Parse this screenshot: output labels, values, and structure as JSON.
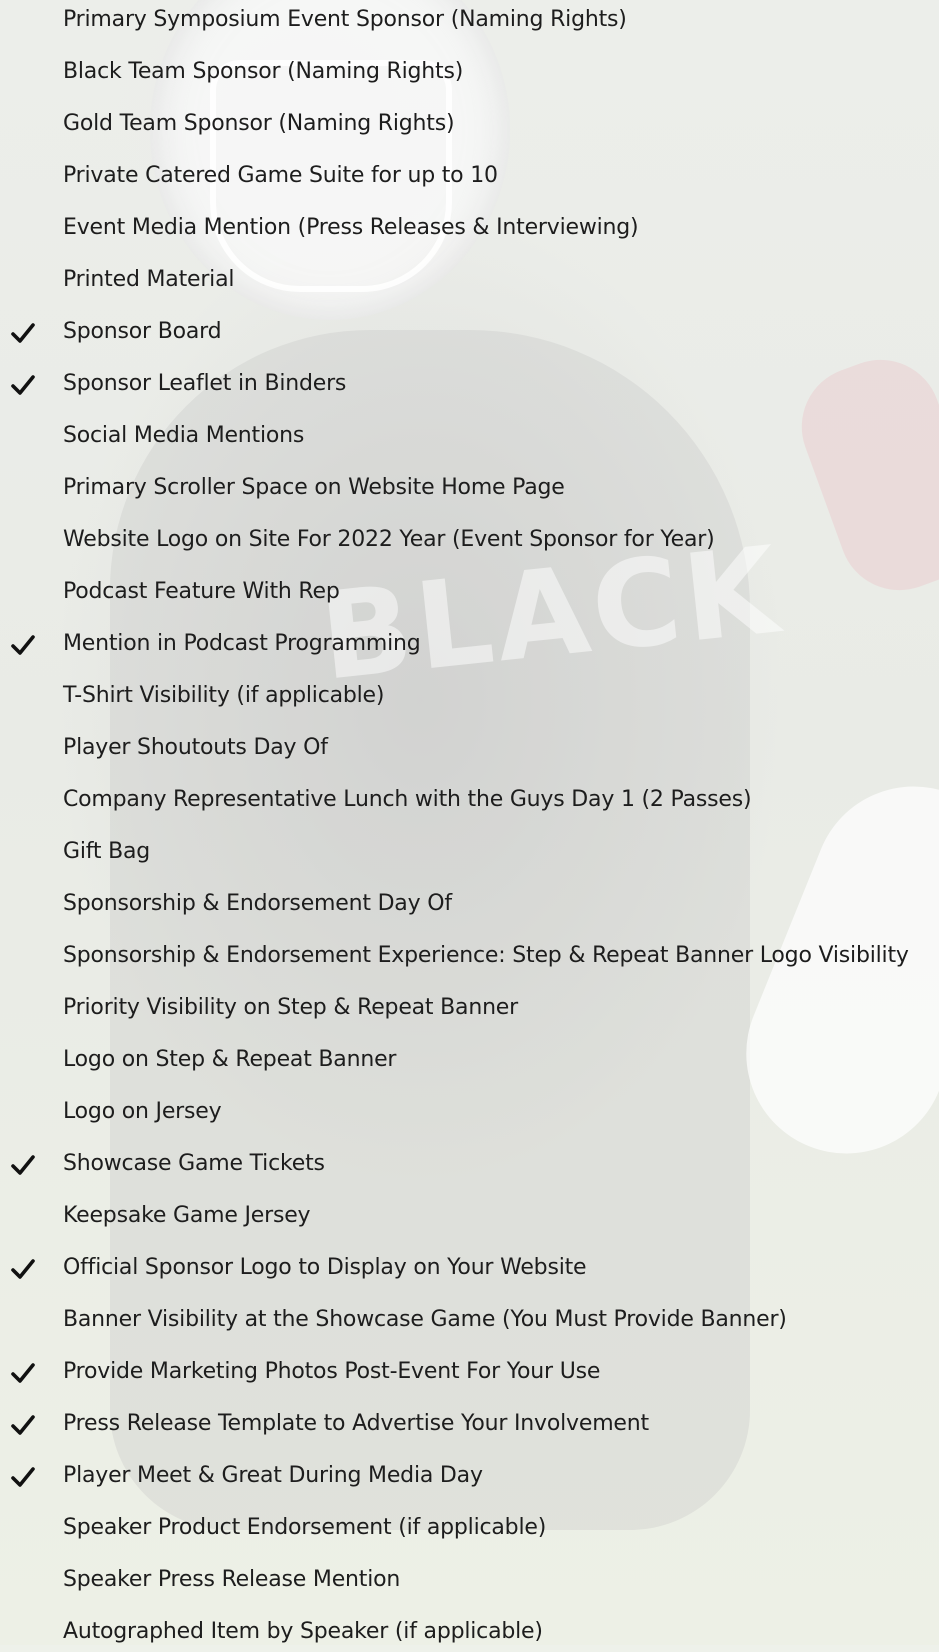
{
  "benefits": [
    {
      "label": "Primary Symposium Event Sponsor (Naming Rights)",
      "included": false
    },
    {
      "label": "Black Team Sponsor (Naming Rights)",
      "included": false
    },
    {
      "label": "Gold Team Sponsor (Naming Rights)",
      "included": false
    },
    {
      "label": "Private Catered Game Suite for up to 10",
      "included": false
    },
    {
      "label": "Event Media Mention (Press Releases & Interviewing)",
      "included": false
    },
    {
      "label": "Printed Material",
      "included": false
    },
    {
      "label": "Sponsor Board",
      "included": true
    },
    {
      "label": "Sponsor Leaflet in Binders",
      "included": true
    },
    {
      "label": "Social Media Mentions",
      "included": false
    },
    {
      "label": "Primary Scroller Space on Website Home Page",
      "included": false
    },
    {
      "label": "Website Logo on Site For 2022 Year (Event Sponsor for Year)",
      "included": false
    },
    {
      "label": "Podcast Feature With Rep",
      "included": false
    },
    {
      "label": "Mention in Podcast Programming",
      "included": true
    },
    {
      "label": "T-Shirt Visibility (if applicable)",
      "included": false
    },
    {
      "label": "Player Shoutouts Day Of",
      "included": false
    },
    {
      "label": "Company Representative Lunch with the Guys Day 1 (2 Passes)",
      "included": false
    },
    {
      "label": "Gift Bag",
      "included": false
    },
    {
      "label": "Sponsorship & Endorsement Day Of",
      "included": false
    },
    {
      "label": "Sponsorship & Endorsement Experience: Step & Repeat Banner Logo Visibility",
      "included": false
    },
    {
      "label": "Priority Visibility on Step & Repeat Banner",
      "included": false
    },
    {
      "label": "Logo on Step & Repeat Banner",
      "included": false
    },
    {
      "label": "Logo on Jersey",
      "included": false
    },
    {
      "label": "Showcase Game Tickets",
      "included": true
    },
    {
      "label": "Keepsake Game Jersey",
      "included": false
    },
    {
      "label": "Official Sponsor Logo to Display on Your Website",
      "included": true
    },
    {
      "label": "Banner Visibility at the Showcase Game (You Must Provide Banner)",
      "included": false
    },
    {
      "label": "Provide Marketing Photos Post-Event For Your Use",
      "included": true
    },
    {
      "label": "Press Release Template to Advertise Your Involvement",
      "included": true
    },
    {
      "label": "Player Meet & Great During Media Day",
      "included": true
    },
    {
      "label": "Speaker Product Endorsement (if applicable)",
      "included": false
    },
    {
      "label": "Speaker Press Release Mention",
      "included": false
    },
    {
      "label": "Autographed Item by Speaker (if applicable)",
      "included": false
    }
  ],
  "check_icon": "check-icon",
  "colors": {
    "text": "#1d1d1d",
    "check": "#111111",
    "background": "#eef1ea"
  }
}
